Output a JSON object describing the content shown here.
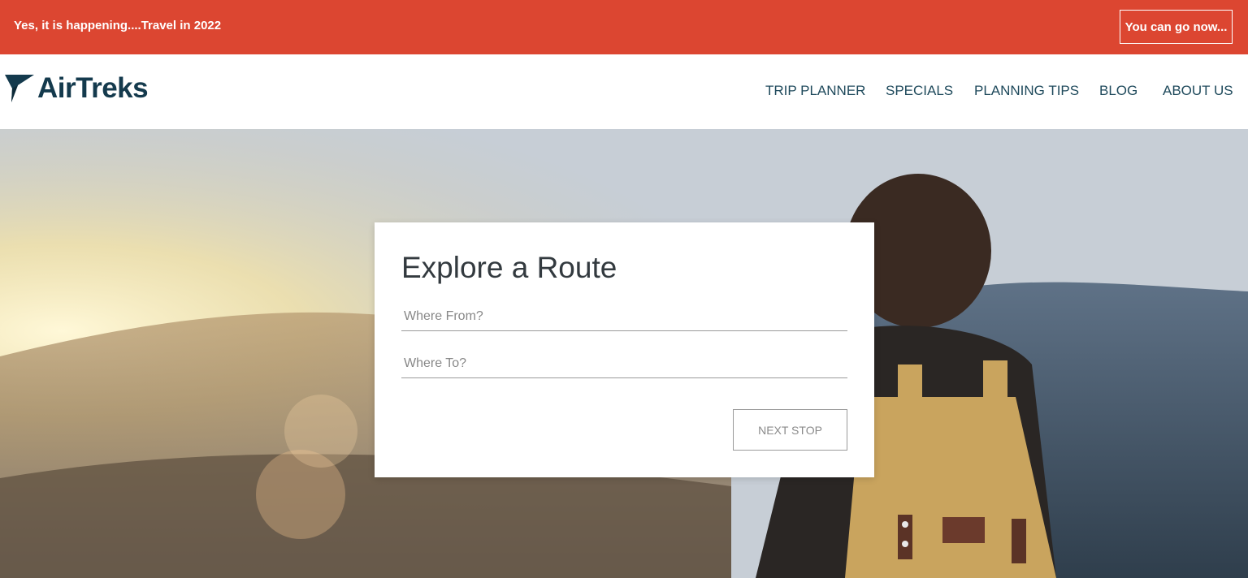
{
  "banner": {
    "message": "Yes, it is happening....Travel in 2022",
    "cta_label": "You can go now...",
    "background_color": "#dc4631"
  },
  "header": {
    "logo_text": "AirTreks",
    "logo_icon": "airtreks-plane-icon",
    "brand_color": "#143a4d",
    "nav": [
      {
        "label": "TRIP PLANNER"
      },
      {
        "label": "SPECIALS"
      },
      {
        "label": "PLANNING TIPS"
      },
      {
        "label": "BLOG"
      },
      {
        "label": "ABOUT US"
      }
    ]
  },
  "hero": {
    "image": "traveler-with-backpack-mountain-view"
  },
  "route_card": {
    "title": "Explore a Route",
    "from_placeholder": "Where From?",
    "to_placeholder": "Where To?",
    "next_label": "NEXT STOP"
  }
}
